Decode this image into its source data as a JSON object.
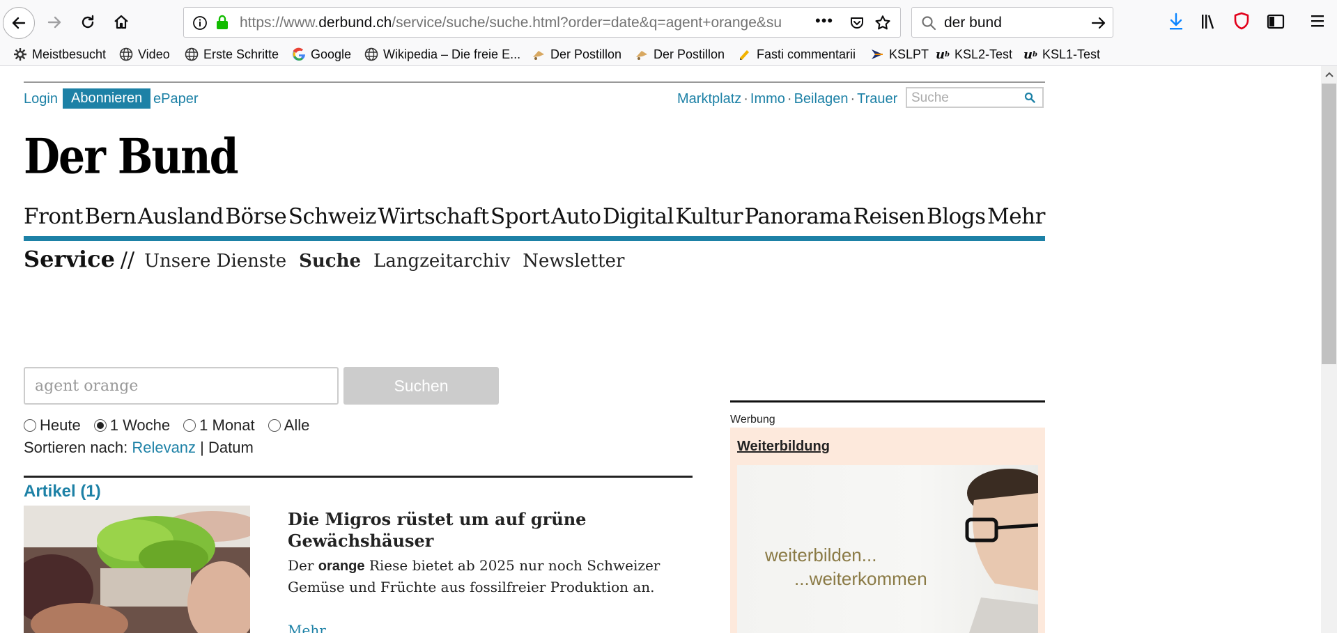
{
  "browser": {
    "url_prefix": "https://www.",
    "url_domain": "derbund.ch",
    "url_path": "/service/suche/suche.html?order=date&q=agent+orange&su",
    "search_query": "der bund",
    "more_actions": "•••"
  },
  "bookmarks": [
    {
      "label": "Meistbesucht",
      "icon": "gear-icon"
    },
    {
      "label": "Video",
      "icon": "globe-icon"
    },
    {
      "label": "Erste Schritte",
      "icon": "globe-icon"
    },
    {
      "label": "Google",
      "icon": "google-icon"
    },
    {
      "label": "Wikipedia – Die freie E...",
      "icon": "globe-icon"
    },
    {
      "label": "Der Postillon",
      "icon": "postillon-icon"
    },
    {
      "label": "Der Postillon",
      "icon": "postillon-icon"
    },
    {
      "label": "Fasti commentarii",
      "icon": "pencil-icon"
    },
    {
      "label": "KSLPT",
      "icon": "kslpt-icon"
    },
    {
      "label": "KSL2-Test",
      "icon": "ub-icon"
    },
    {
      "label": "KSL1-Test",
      "icon": "ub-icon"
    }
  ],
  "header": {
    "login": "Login",
    "abonnieren": "Abonnieren",
    "epaper": "ePaper",
    "service_links": [
      "Marktplatz",
      "Immo",
      "Beilagen",
      "Trauer"
    ],
    "link_separator": "·",
    "search_placeholder": "Suche",
    "logo_text": "Der Bund"
  },
  "main_nav": [
    "Front",
    "Bern",
    "Ausland",
    "Börse",
    "Schweiz",
    "Wirtschaft",
    "Sport",
    "Auto",
    "Digital",
    "Kultur",
    "Panorama",
    "Reisen",
    "Blogs",
    "Mehr"
  ],
  "sub_nav": {
    "section": "Service",
    "separator": "//",
    "items": [
      "Unsere Dienste",
      "Suche",
      "Langzeitarchiv",
      "Newsletter"
    ],
    "active": "Suche"
  },
  "search": {
    "value": "agent orange",
    "button": "Suchen",
    "time_filters": [
      "Heute",
      "1 Woche",
      "1 Monat",
      "Alle"
    ],
    "selected_filter": "1 Woche",
    "sort_label": "Sortieren nach:",
    "sort_relevance": "Relevanz",
    "sort_separator": "|",
    "sort_date": "Datum"
  },
  "results": {
    "section_title": "Artikel (1)",
    "items": [
      {
        "headline": "Die Migros rüstet um auf grüne Gewächshäuser",
        "teaser_before": "Der",
        "teaser_highlight": "orange",
        "teaser_after": "Riese bietet ab 2025 nur noch Schweizer Gemüse und Früchte aus fossilfreier Produktion an.",
        "more": "Mehr..."
      }
    ]
  },
  "ad": {
    "label": "Werbung",
    "title": "Weiterbildung",
    "line1": "weiterbilden...",
    "line2": "...weiterkommen"
  },
  "colors": {
    "accent": "#1d81a6",
    "ad_background": "#fde9dc",
    "button_disabled": "#cccccc"
  }
}
